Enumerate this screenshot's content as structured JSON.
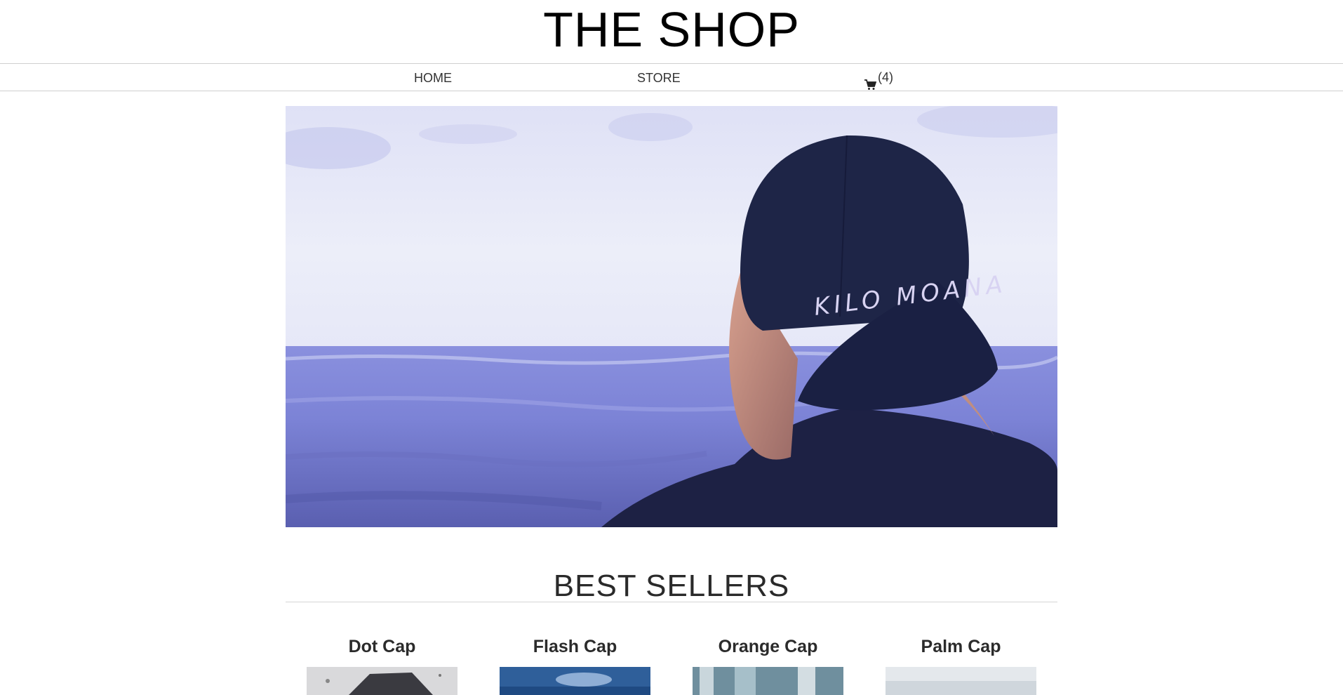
{
  "header": {
    "title": "THE SHOP"
  },
  "nav": {
    "home": "HOME",
    "store": "STORE",
    "cart_count": "(4)",
    "cart_icon": "shopping-cart-icon"
  },
  "hero": {
    "cap_text": "KILO MOANA"
  },
  "best_sellers": {
    "title": "BEST SELLERS",
    "products": [
      {
        "name": "Dot Cap"
      },
      {
        "name": "Flash Cap"
      },
      {
        "name": "Orange Cap"
      },
      {
        "name": "Palm Cap"
      }
    ]
  },
  "colors": {
    "text": "#222222",
    "rule": "#cfcfcf",
    "sea": "#7b82d6",
    "cap": "#1e2547"
  }
}
